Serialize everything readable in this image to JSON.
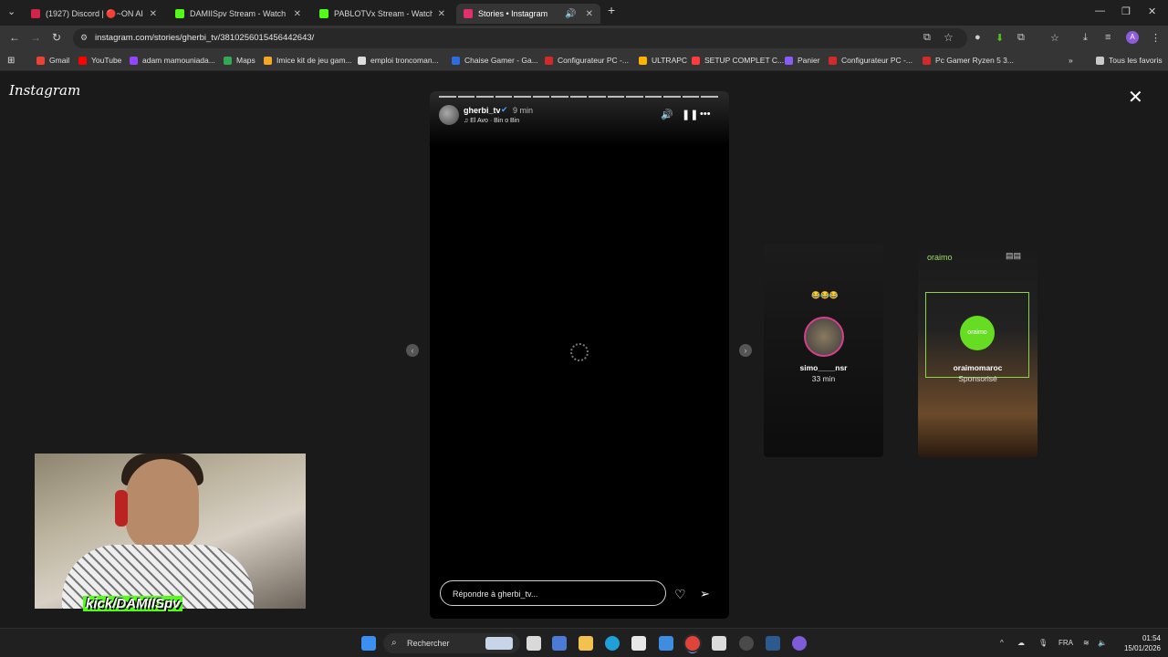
{
  "tabs": [
    {
      "title": "(1927) Discord | 🔴~ON AI",
      "active": false,
      "color": "#d0244a"
    },
    {
      "title": "DAMIISpv Stream - Watch Live",
      "active": false,
      "color": "#53fc18"
    },
    {
      "title": "PABLOTVx Stream - Watch Live",
      "active": false,
      "color": "#53fc18"
    },
    {
      "title": "Stories • Instagram",
      "active": true,
      "color": "#e1306c"
    }
  ],
  "address": {
    "url": "instagram.com/stories/gherbi_tv/3810256015456442643/"
  },
  "bookmarks": [
    {
      "label": "Gmail",
      "color": "#ea4335"
    },
    {
      "label": "YouTube",
      "color": "#ff0000"
    },
    {
      "label": "adam mamouniada...",
      "color": "#9146ff"
    },
    {
      "label": "Maps",
      "color": "#34a853"
    },
    {
      "label": "Imice kit de jeu gam...",
      "color": "#f5a623"
    },
    {
      "label": "emploi troncoman...",
      "color": "#dddddd"
    },
    {
      "label": "Chaise Gamer - Ga...",
      "color": "#2d6cdf"
    },
    {
      "label": "Configurateur PC -...",
      "color": "#d12a2a"
    },
    {
      "label": "ULTRAPC",
      "color": "#ffb300"
    },
    {
      "label": "SETUP COMPLET C...",
      "color": "#ff3b3b"
    },
    {
      "label": "Panier",
      "color": "#8a5cf6"
    },
    {
      "label": "Configurateur PC -...",
      "color": "#d12a2a"
    },
    {
      "label": "Pc Gamer Ryzen 5 3...",
      "color": "#d12a2a"
    }
  ],
  "all_bookmarks": "Tous les favoris",
  "instagram": {
    "logo": "Instagram"
  },
  "story": {
    "username": "gherbi_tv",
    "time": "9 min",
    "music": "El Avo · Bin o Bin",
    "reply_placeholder": "Répondre à gherbi_tv..."
  },
  "next_stories": [
    {
      "username": "simo____nsr",
      "sub": "33 min"
    },
    {
      "username": "oraimomaroc",
      "sub": "Sponsorisé",
      "brand": "oraimo"
    }
  ],
  "overlay": {
    "kick": "kick/DAMIISpv"
  },
  "taskbar": {
    "search": "Rechercher",
    "lang": "FRA",
    "time": "01:54",
    "date": "15/01/2026"
  }
}
